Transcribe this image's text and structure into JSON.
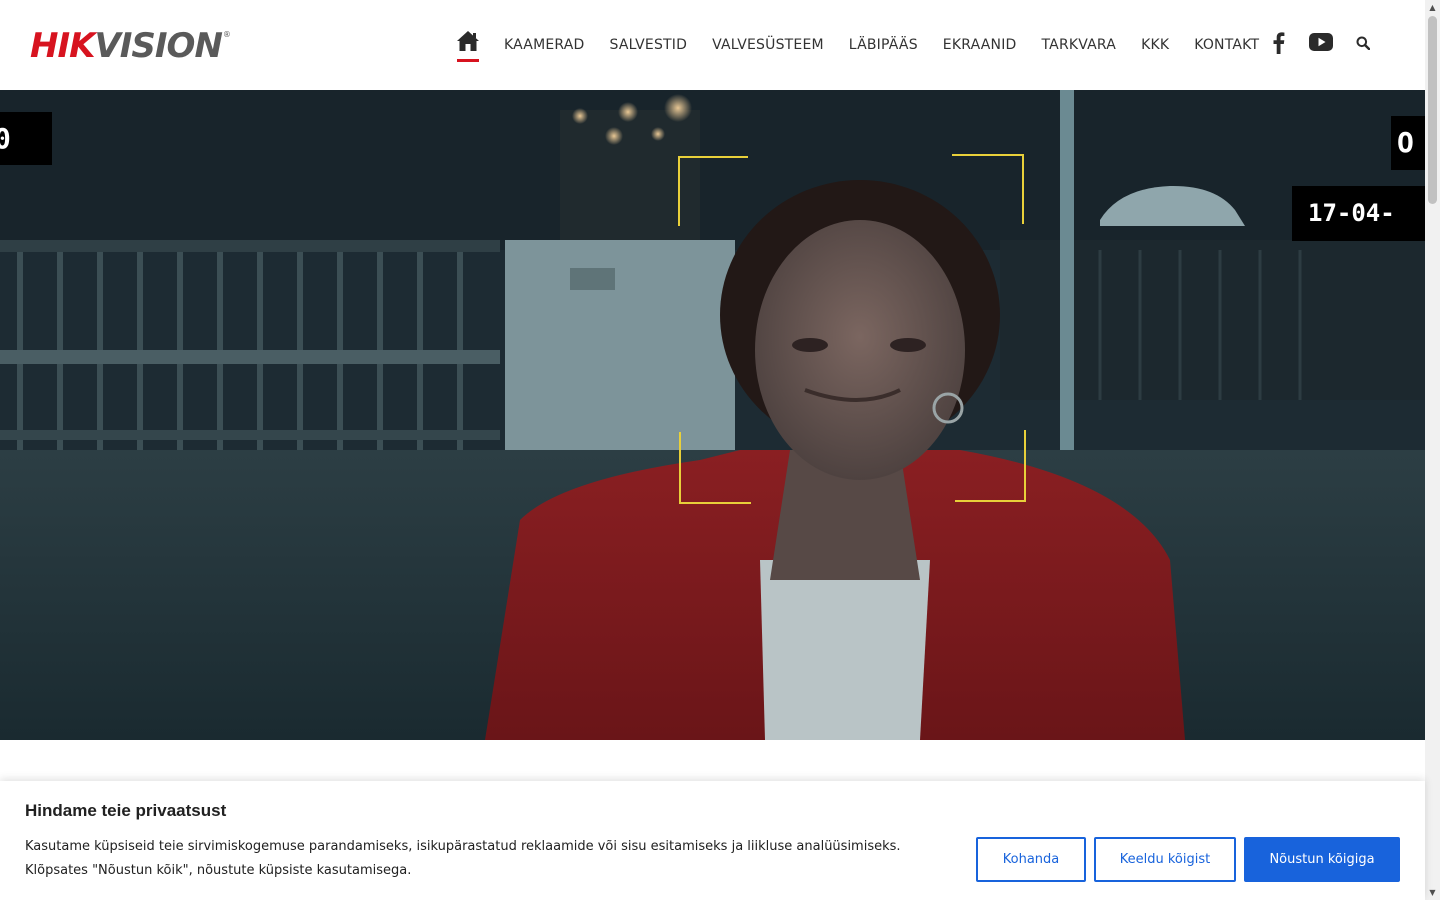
{
  "brand": {
    "part1": "HIK",
    "part2": "VISION",
    "reg": "®"
  },
  "nav": {
    "home_icon": "home-icon",
    "items": [
      {
        "label": "KAAMERAD"
      },
      {
        "label": "SALVESTID"
      },
      {
        "label": "VALVESÜSTEEM"
      },
      {
        "label": "LÄBIPÄÄS"
      },
      {
        "label": "EKRAANID"
      },
      {
        "label": "TARKVARA"
      },
      {
        "label": "KKK"
      },
      {
        "label": "KONTAKT"
      }
    ],
    "social": [
      "facebook-icon",
      "youtube-icon"
    ],
    "search_icon": "search-icon"
  },
  "hero": {
    "osd_left": "0",
    "osd_right": "O",
    "osd_date": "17-04-",
    "frame_color": "#e8d03a"
  },
  "cookie": {
    "title": "Hindame teie privaatsust",
    "text": "Kasutame küpsiseid teie sirvimiskogemuse parandamiseks, isikupärastatud reklaamide või sisu esitamiseks ja liikluse analüüsimiseks. Klõpsates \"Nõustun kõik\", nõustute küpsiste kasutamisega.",
    "customize": "Kohanda",
    "reject": "Keeldu kõigist",
    "accept": "Nõustun kõigiga"
  },
  "colors": {
    "brand_red": "#d7131f",
    "button_blue": "#1863dc"
  }
}
